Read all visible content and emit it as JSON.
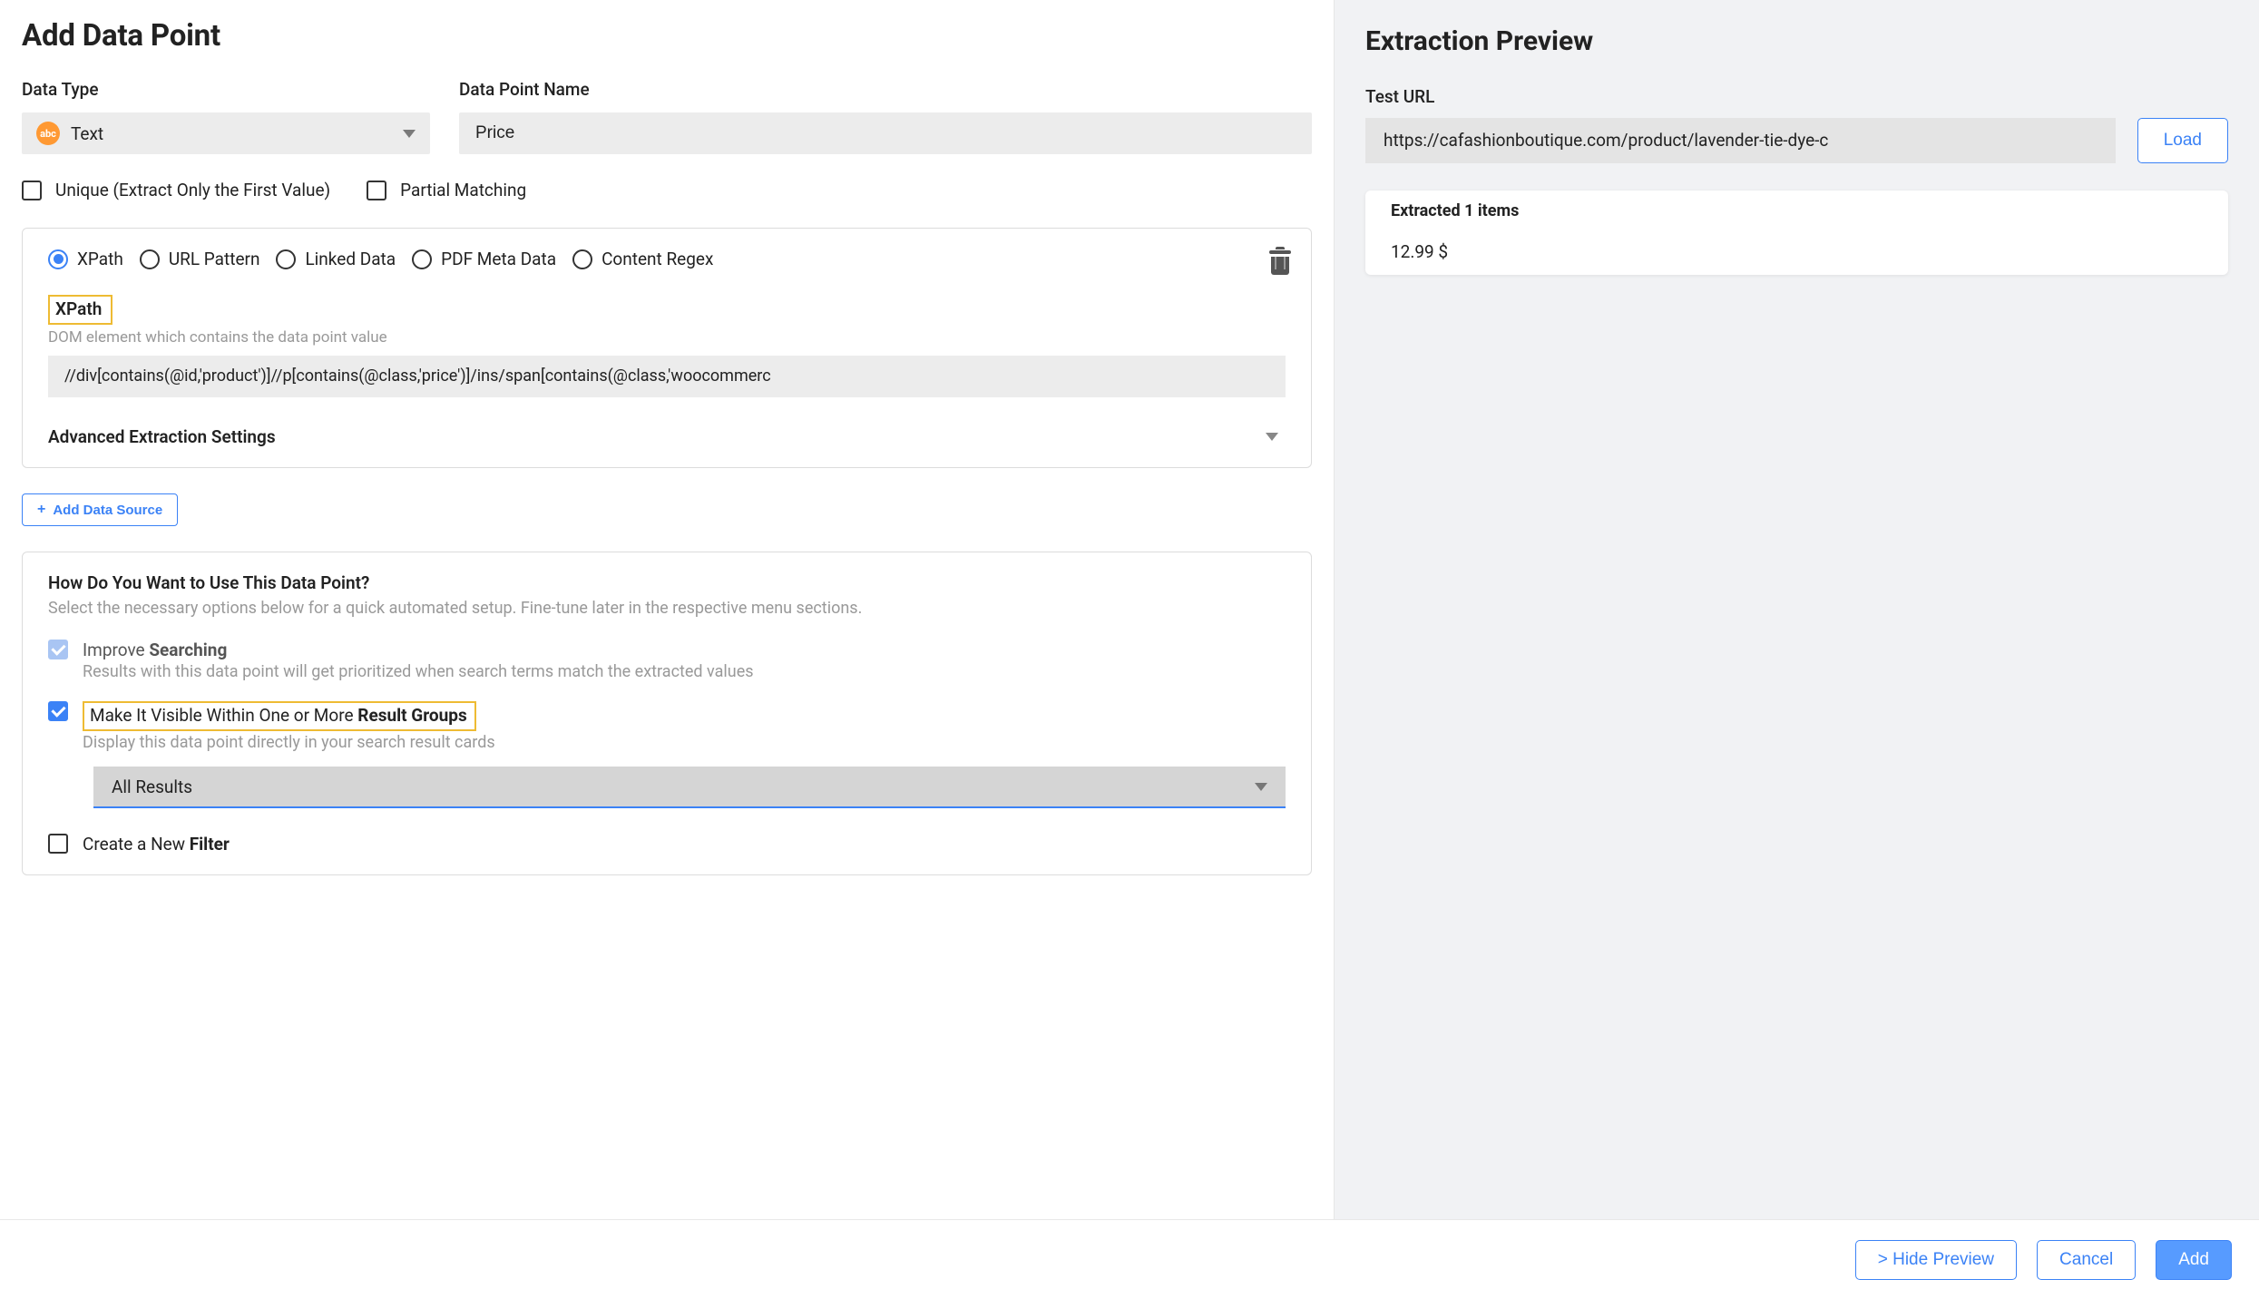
{
  "pageTitle": "Add Data Point",
  "fields": {
    "dataTypeLabel": "Data Type",
    "dataTypeValue": "Text",
    "abcIcon": "abc",
    "dataNameLabel": "Data Point Name",
    "dataNameValue": "Price"
  },
  "checks": {
    "uniqueLabel": "Unique (Extract Only the First Value)",
    "partialLabel": "Partial Matching"
  },
  "source": {
    "radios": {
      "xpath": "XPath",
      "urlPattern": "URL Pattern",
      "linkedData": "Linked Data",
      "pdfMeta": "PDF Meta Data",
      "contentRegex": "Content Regex"
    },
    "xpathTitle": "XPath",
    "xpathHelper": "DOM element which contains the data point value",
    "xpathValue": "//div[contains(@id,'product')]//p[contains(@class,'price')]/ins/span[contains(@class,'woocommerc",
    "advanced": "Advanced Extraction Settings",
    "addSource": "Add Data Source"
  },
  "usage": {
    "title": "How Do You Want to Use This Data Point?",
    "subtitle": "Select the necessary options below for a quick automated setup. Fine-tune later in the respective menu sections.",
    "improve1": "Improve ",
    "improve2": "Searching",
    "improveSub": "Results with this data point will get prioritized when search terms match the extracted values",
    "result1": "Make It Visible Within One or More ",
    "result2": "Result Groups",
    "resultSub": "Display this data point directly in your search result cards",
    "resultSelect": "All Results",
    "filter1": "Create a New ",
    "filter2": "Filter"
  },
  "preview": {
    "title": "Extraction Preview",
    "testUrlLabel": "Test URL",
    "testUrlValue": "https://cafashionboutique.com/product/lavender-tie-dye-c",
    "loadBtn": "Load",
    "extractedHeader": "Extracted 1 items",
    "items": [
      "12.99 $"
    ]
  },
  "footer": {
    "hide": "> Hide Preview",
    "cancel": "Cancel",
    "add": "Add"
  }
}
